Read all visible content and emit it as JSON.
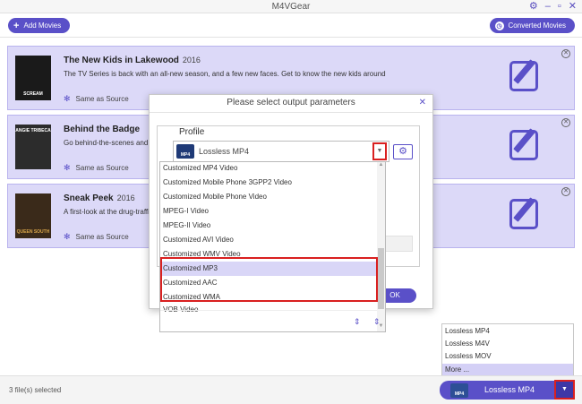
{
  "window": {
    "title": "M4VGear",
    "controls": [
      "gear-icon",
      "minimize-icon",
      "maximize-icon",
      "close-icon"
    ]
  },
  "toolbar": {
    "add_movies_label": "Add Movies",
    "converted_movies_label": "Converted Movies"
  },
  "movies": [
    {
      "title": "The New Kids in Lakewood",
      "year": "2016",
      "description": "The TV Series is back with an all-new season, and a few new faces. Get to know the new kids around",
      "source": "Same as Source",
      "poster_text": "SCREAM"
    },
    {
      "title": "Behind the Badge",
      "year": "2016",
      "description": "Go behind-the-scenes and",
      "source": "Same as Source",
      "poster_text": "ANGIE TRIBECA"
    },
    {
      "title": "Sneak Peek",
      "year": "2016",
      "description": "A first-look at the drug-traffic",
      "source": "Same as Source",
      "poster_text": "QUEEN SOUTH"
    }
  ],
  "dialog": {
    "title": "Please select output parameters",
    "profile_label": "Profile",
    "profile_value": "Lossless MP4",
    "icon_text": "MP4",
    "ok_label": "OK"
  },
  "dropdown": {
    "items": [
      "Customized MP4 Video",
      "Customized Mobile Phone 3GPP2 Video",
      "Customized Mobile Phone Video",
      "MPEG-I Video",
      "MPEG-II Video",
      "Customized AVI Video",
      "Customized WMV Video",
      "Customized MP3",
      "Customized AAC",
      "Customized WMA",
      "VOB Video"
    ],
    "highlighted": "Customized MP3"
  },
  "format_menu": {
    "items": [
      "Lossless MP4",
      "Lossless M4V",
      "Lossless MOV",
      "More ..."
    ],
    "selected": "More ..."
  },
  "status": {
    "selected_text": "3 file(s) selected",
    "format_value": "Lossless MP4",
    "icon_text": "MP4"
  },
  "colors": {
    "accent": "#5a50c8",
    "card_bg": "#dcd9f8",
    "highlight_border": "#d92020"
  }
}
